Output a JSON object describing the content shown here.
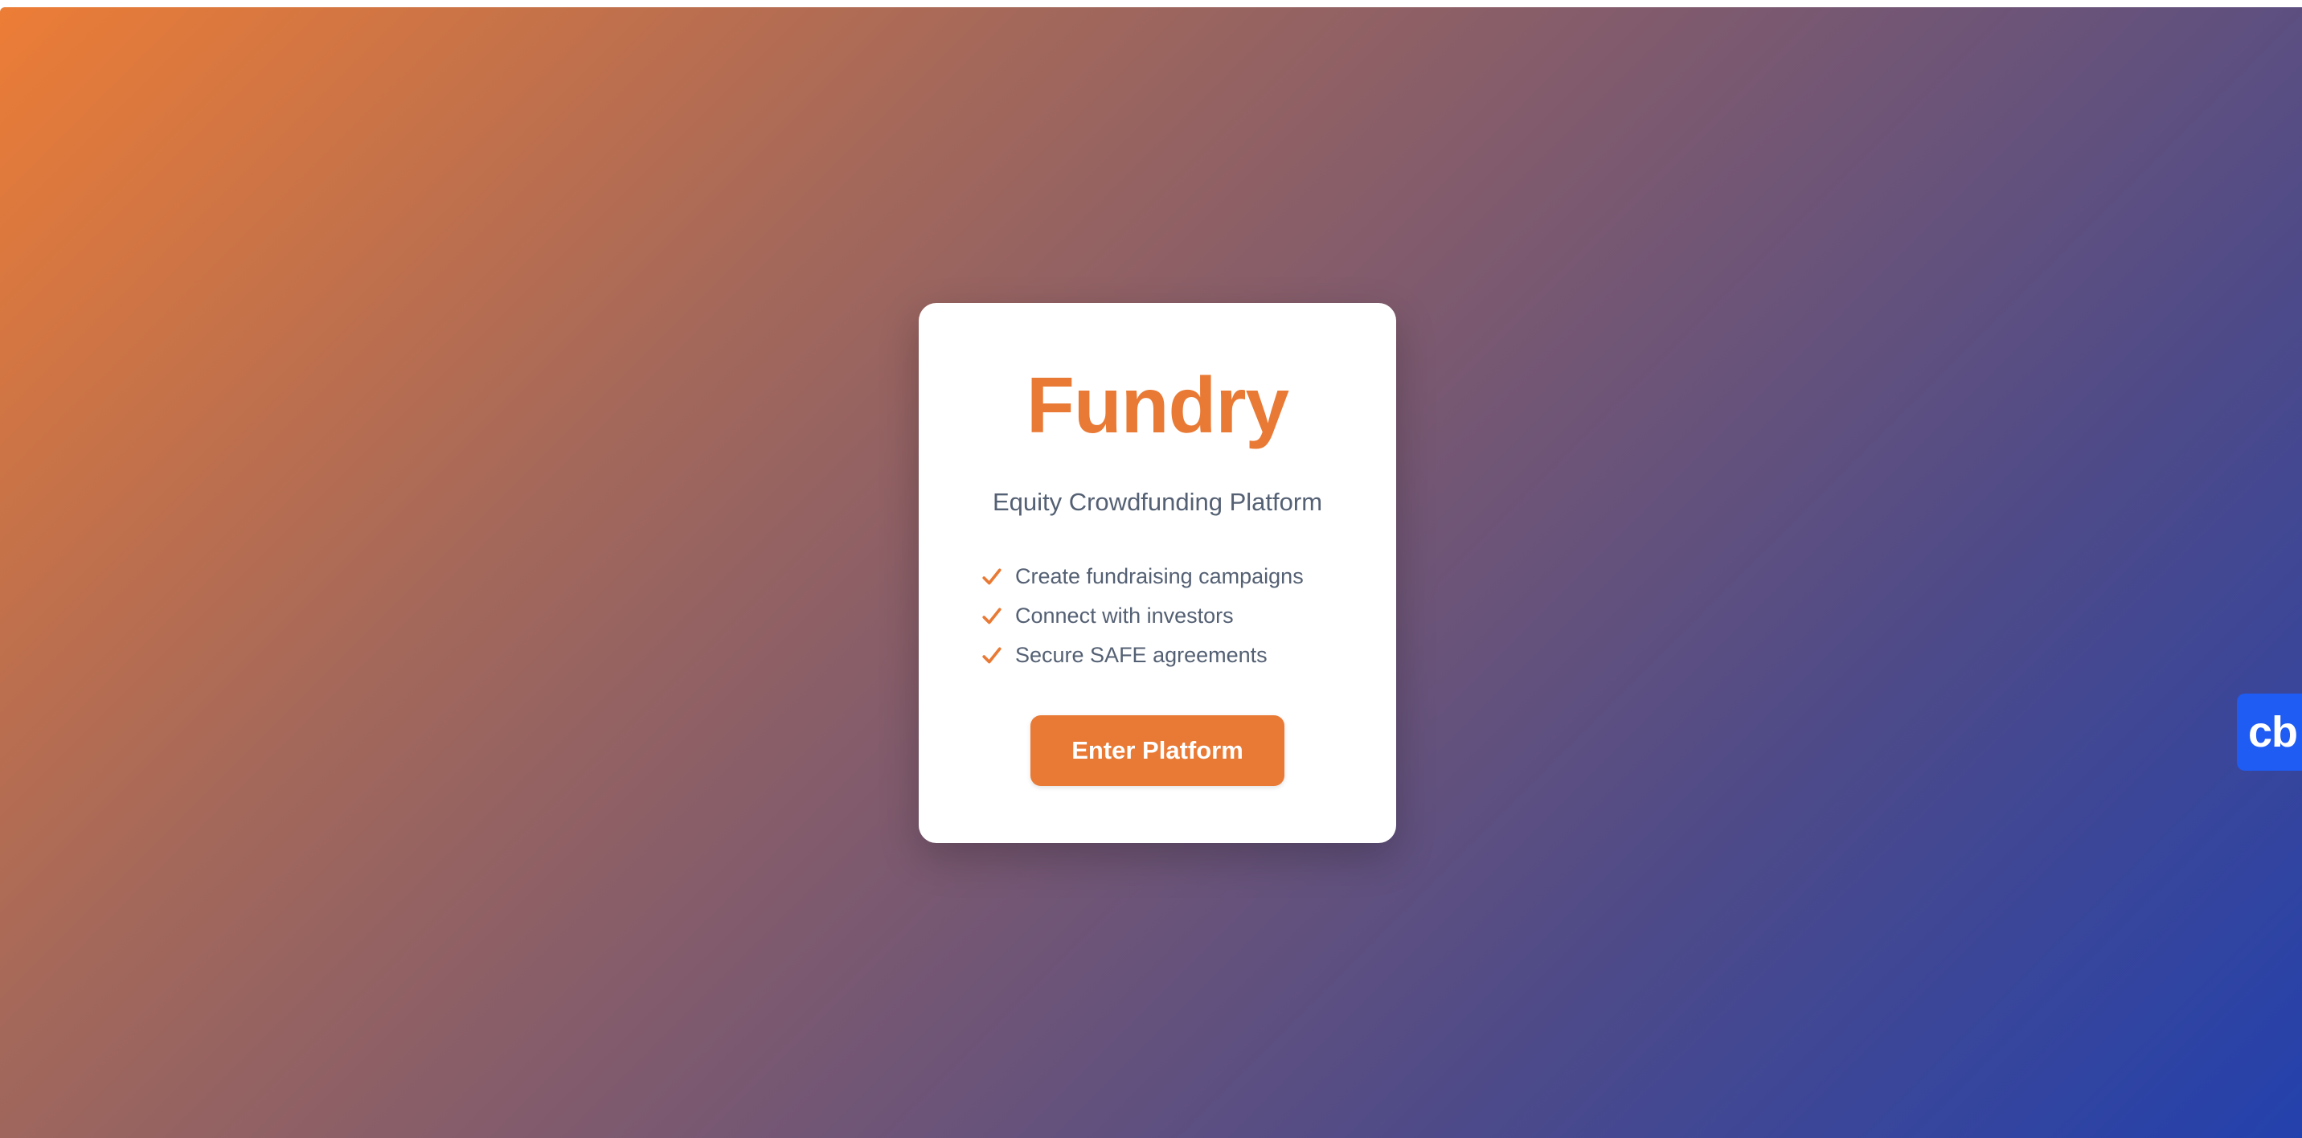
{
  "brand": {
    "title": "Fundry",
    "tagline": "Equity Crowdfunding Platform",
    "accent_color": "#e97a35"
  },
  "features": [
    {
      "icon": "check-icon",
      "label": "Create fundraising campaigns"
    },
    {
      "icon": "check-icon",
      "label": "Connect with investors"
    },
    {
      "icon": "check-icon",
      "label": "Secure SAFE agreements"
    }
  ],
  "cta": {
    "label": "Enter Platform"
  },
  "side_widget": {
    "label": "cb",
    "color": "#1f5cf3"
  }
}
